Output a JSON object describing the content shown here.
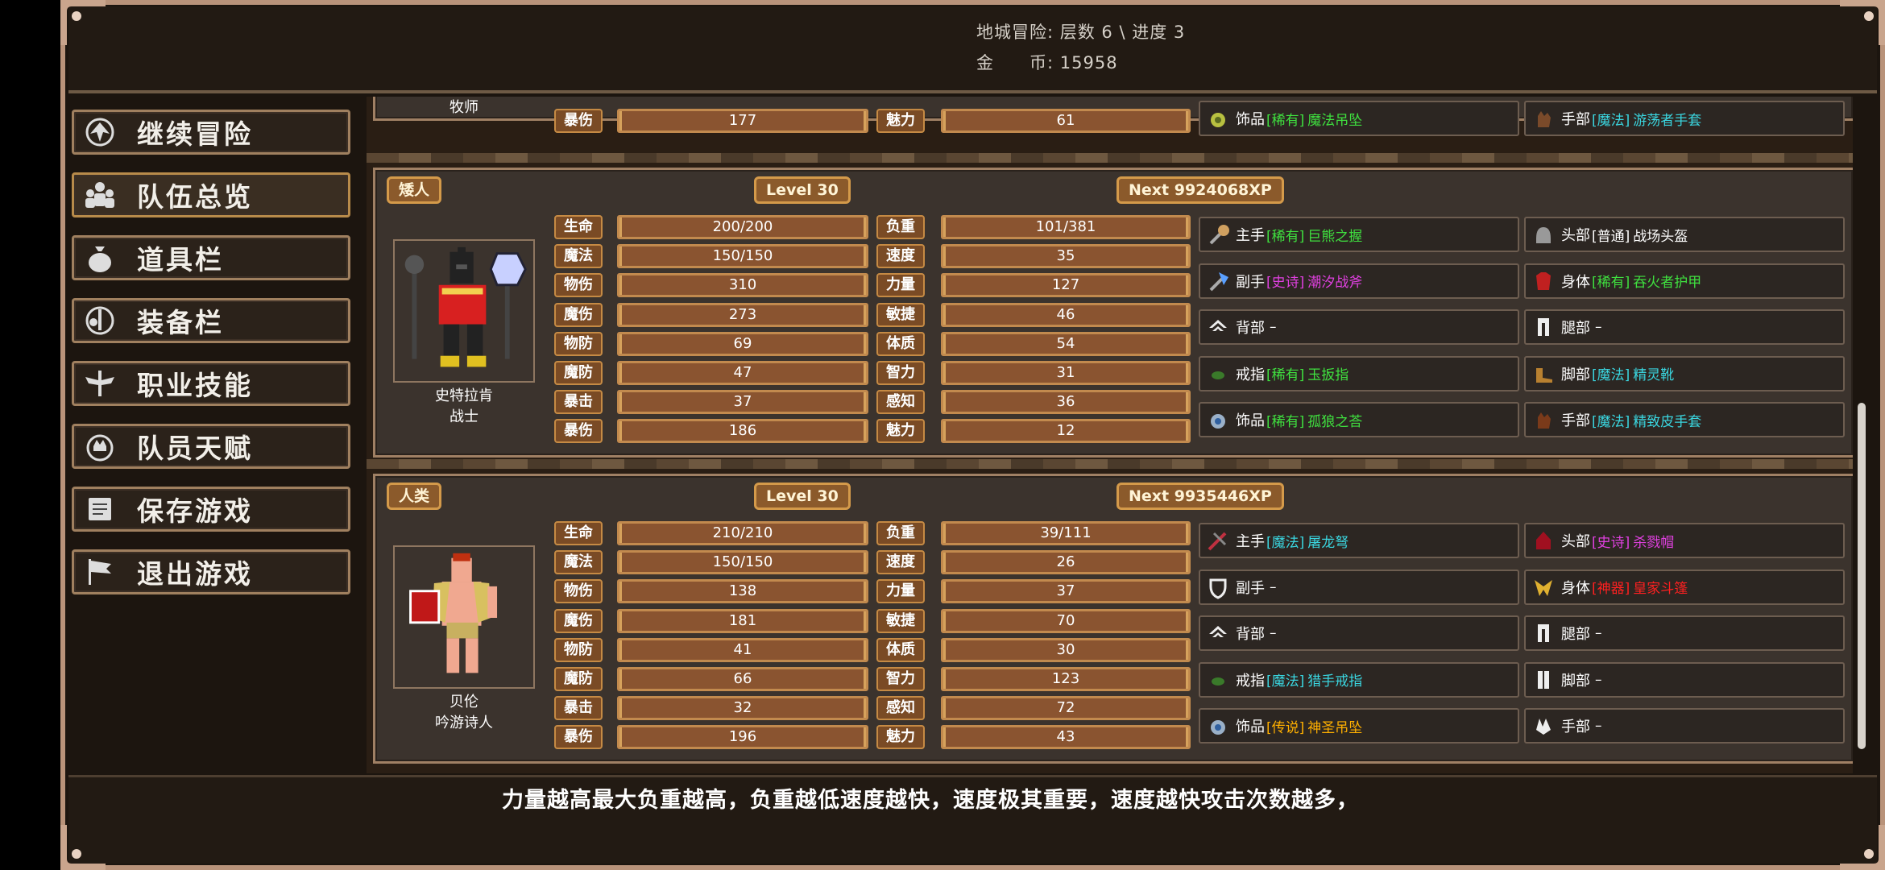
{
  "header": {
    "dungeon_label": "地城冒险: 层数 6 \\ 进度 3",
    "gold_label": "金　　币: 15958"
  },
  "menu": [
    {
      "label": "继续冒险",
      "icon": "dragon-icon"
    },
    {
      "label": "队伍总览",
      "icon": "party-icon"
    },
    {
      "label": "道具栏",
      "icon": "bag-icon"
    },
    {
      "label": "装备栏",
      "icon": "equipment-icon"
    },
    {
      "label": "职业技能",
      "icon": "sword-wings-icon"
    },
    {
      "label": "队员天赋",
      "icon": "laurel-crown-icon"
    },
    {
      "label": "保存游戏",
      "icon": "scroll-icon"
    },
    {
      "label": "退出游戏",
      "icon": "flag-icon"
    }
  ],
  "partial_card": {
    "class_name": "牧师",
    "stat_left_label": "暴伤",
    "stat_left_value": "177",
    "stat_right_label": "魅力",
    "stat_right_value": "61",
    "slot_left": {
      "part": "饰品",
      "rarity": "[稀有]",
      "item": "魔法吊坠"
    },
    "slot_right": {
      "part": "手部",
      "rarity": "[魔法]",
      "item": "游荡者手套"
    }
  },
  "members": [
    {
      "race": "矮人",
      "level": "Level 30",
      "next_xp": "Next 9924068XP",
      "name": "史特拉肯",
      "class_name": "战士",
      "stats_left": [
        {
          "label": "生命",
          "value": "200/200"
        },
        {
          "label": "魔法",
          "value": "150/150"
        },
        {
          "label": "物伤",
          "value": "310"
        },
        {
          "label": "魔伤",
          "value": "273"
        },
        {
          "label": "物防",
          "value": "69"
        },
        {
          "label": "魔防",
          "value": "47"
        },
        {
          "label": "暴击",
          "value": "37"
        },
        {
          "label": "暴伤",
          "value": "186"
        }
      ],
      "stats_right": [
        {
          "label": "负重",
          "value": "101/381"
        },
        {
          "label": "速度",
          "value": "35"
        },
        {
          "label": "力量",
          "value": "127"
        },
        {
          "label": "敏捷",
          "value": "46"
        },
        {
          "label": "体质",
          "value": "54"
        },
        {
          "label": "智力",
          "value": "31"
        },
        {
          "label": "感知",
          "value": "36"
        },
        {
          "label": "魅力",
          "value": "12"
        }
      ],
      "slots": [
        {
          "part": "主手",
          "rarity": "[稀有]",
          "item": "巨熊之握",
          "color": "#3fe03f",
          "icon": "mace-icon"
        },
        {
          "part": "头部",
          "rarity": "[普通]",
          "item": "战场头盔",
          "color": "#ffffff",
          "icon": "helmet-icon"
        },
        {
          "part": "副手",
          "rarity": "[史诗]",
          "item": "潮汐战斧",
          "color": "#e040e0",
          "icon": "axe-icon"
        },
        {
          "part": "身体",
          "rarity": "[稀有]",
          "item": "吞火者护甲",
          "color": "#3fe03f",
          "icon": "armor-icon"
        },
        {
          "part": "背部",
          "rarity": "",
          "item": "–",
          "color": "#ffffff",
          "icon": "back-slot-icon"
        },
        {
          "part": "腿部",
          "rarity": "",
          "item": "–",
          "color": "#ffffff",
          "icon": "legs-slot-icon"
        },
        {
          "part": "戒指",
          "rarity": "[稀有]",
          "item": "玉扳指",
          "color": "#3fe03f",
          "icon": "ring-icon"
        },
        {
          "part": "脚部",
          "rarity": "[魔法]",
          "item": "精灵靴",
          "color": "#3ad6e0",
          "icon": "boots-icon"
        },
        {
          "part": "饰品",
          "rarity": "[稀有]",
          "item": "孤狼之荅",
          "color": "#3fe03f",
          "icon": "amulet-icon"
        },
        {
          "part": "手部",
          "rarity": "[魔法]",
          "item": "精致皮手套",
          "color": "#3ad6e0",
          "icon": "gloves-icon"
        }
      ]
    },
    {
      "race": "人类",
      "level": "Level 30",
      "next_xp": "Next 9935446XP",
      "name": "贝伦",
      "class_name": "吟游诗人",
      "stats_left": [
        {
          "label": "生命",
          "value": "210/210"
        },
        {
          "label": "魔法",
          "value": "150/150"
        },
        {
          "label": "物伤",
          "value": "138"
        },
        {
          "label": "魔伤",
          "value": "181"
        },
        {
          "label": "物防",
          "value": "41"
        },
        {
          "label": "魔防",
          "value": "66"
        },
        {
          "label": "暴击",
          "value": "32"
        },
        {
          "label": "暴伤",
          "value": "196"
        }
      ],
      "stats_right": [
        {
          "label": "负重",
          "value": "39/111"
        },
        {
          "label": "速度",
          "value": "26"
        },
        {
          "label": "力量",
          "value": "37"
        },
        {
          "label": "敏捷",
          "value": "70"
        },
        {
          "label": "体质",
          "value": "30"
        },
        {
          "label": "智力",
          "value": "123"
        },
        {
          "label": "感知",
          "value": "72"
        },
        {
          "label": "魅力",
          "value": "43"
        }
      ],
      "slots": [
        {
          "part": "主手",
          "rarity": "[魔法]",
          "item": "屠龙弩",
          "color": "#3ad6e0",
          "icon": "crossbow-icon"
        },
        {
          "part": "头部",
          "rarity": "[史诗]",
          "item": "杀戮帽",
          "color": "#e040e0",
          "icon": "hood-icon"
        },
        {
          "part": "副手",
          "rarity": "",
          "item": "–",
          "color": "#ffffff",
          "icon": "shield-slot-icon"
        },
        {
          "part": "身体",
          "rarity": "[神器]",
          "item": "皇家斗篷",
          "color": "#ff2020",
          "icon": "cloak-icon"
        },
        {
          "part": "背部",
          "rarity": "",
          "item": "–",
          "color": "#ffffff",
          "icon": "back-slot-icon"
        },
        {
          "part": "腿部",
          "rarity": "",
          "item": "–",
          "color": "#ffffff",
          "icon": "legs-slot-icon"
        },
        {
          "part": "戒指",
          "rarity": "[魔法]",
          "item": "猎手戒指",
          "color": "#3ad6e0",
          "icon": "ring-icon"
        },
        {
          "part": "脚部",
          "rarity": "",
          "item": "–",
          "color": "#ffffff",
          "icon": "boots-slot-icon"
        },
        {
          "part": "饰品",
          "rarity": "[传说]",
          "item": "神圣吊坠",
          "color": "#ffb000",
          "icon": "amulet-icon"
        },
        {
          "part": "手部",
          "rarity": "",
          "item": "–",
          "color": "#ffffff",
          "icon": "gloves-slot-icon"
        }
      ]
    }
  ],
  "tip": "力量越高最大负重越高，负重越低速度越快，速度极其重要，速度越快攻击次数越多，"
}
